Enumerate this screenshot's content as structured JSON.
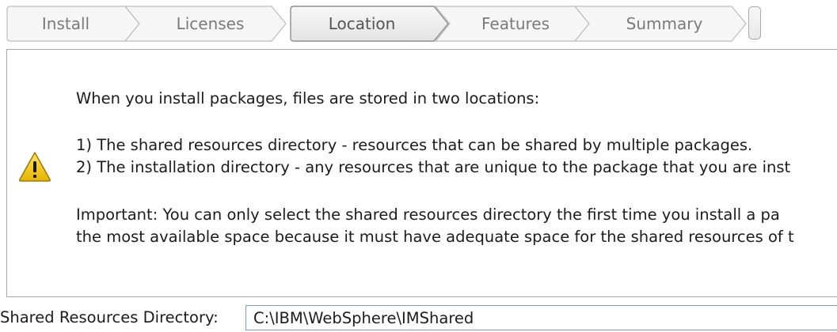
{
  "wizard": {
    "steps": [
      {
        "label": "Install",
        "state": "inactive"
      },
      {
        "label": "Licenses",
        "state": "inactive"
      },
      {
        "label": "Location",
        "state": "active"
      },
      {
        "label": "Features",
        "state": "inactive"
      },
      {
        "label": "Summary",
        "state": "inactive"
      }
    ]
  },
  "info": {
    "icon": "warning-icon",
    "intro": "When you install packages, files are stored in two locations:",
    "item1": "1) The shared resources directory - resources that can be shared by multiple packages.",
    "item2": "2) The installation directory - any resources that are unique to the package that you are inst",
    "important_line1": "Important: You can only select the shared resources directory the first time you install a pa",
    "important_line2": "the most available space because it must have adequate space for the shared resources of t"
  },
  "shared_dir": {
    "label": "Shared Resources Directory:",
    "value": "C:\\IBM\\WebSphere\\IMShared"
  },
  "colors": {
    "step_border": "#a9a9a9",
    "step_fill_top": "#f7f7f7",
    "step_fill_bottom": "#e9e9e9",
    "input_border": "#7a9cc6",
    "warning_yellow": "#f2c21b"
  }
}
